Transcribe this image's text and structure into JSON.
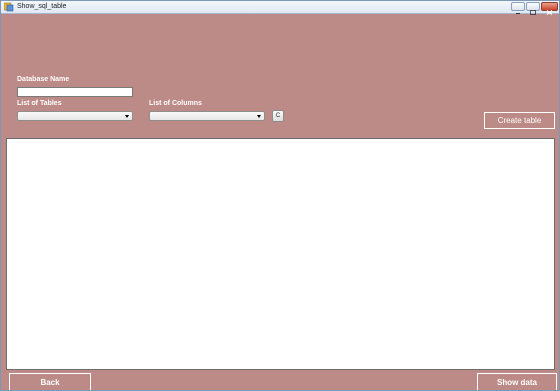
{
  "window": {
    "title": "Show_sql_table"
  },
  "form": {
    "database_name_label": "Database Name",
    "database_name_value": "",
    "tables_label": "List of Tables",
    "tables_selected": "",
    "columns_label": "List of Columns",
    "columns_selected": "",
    "clear_button_label": "C",
    "create_table_label": "Create table"
  },
  "footer": {
    "back_label": "Back",
    "show_data_label": "Show data"
  },
  "colors": {
    "form_background": "#bc8a87",
    "grid_background": "#ffffff"
  }
}
